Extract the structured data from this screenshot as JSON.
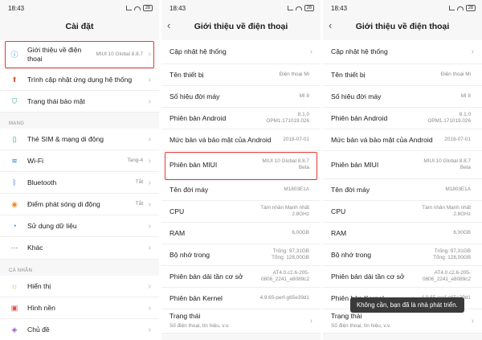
{
  "status": {
    "time": "18:43",
    "battery": "28"
  },
  "p1": {
    "title": "Cài đặt",
    "items_top": [
      {
        "label": "Giới thiệu về điện thoại",
        "value": "MIUI 10 Global 8.8.7",
        "icon": "info-icon"
      },
      {
        "label": "Trình cập nhật ứng dụng hệ thống",
        "value": "",
        "icon": "update-icon"
      },
      {
        "label": "Trạng thái bảo mật",
        "value": "",
        "icon": "shield-icon"
      }
    ],
    "section_network": "MẠNG",
    "items_network": [
      {
        "label": "Thẻ SIM & mạng di động",
        "value": "",
        "icon": "sim-icon"
      },
      {
        "label": "Wi-Fi",
        "value": "Tang-4",
        "icon": "wifi-icon"
      },
      {
        "label": "Bluetooth",
        "value": "Tắt",
        "icon": "bluetooth-icon"
      },
      {
        "label": "Điểm phát sóng di động",
        "value": "Tắt",
        "icon": "hotspot-icon"
      },
      {
        "label": "Sử dụng dữ liệu",
        "value": "",
        "icon": "data-usage-icon"
      },
      {
        "label": "Khác",
        "value": "",
        "icon": "more-icon"
      }
    ],
    "section_personal": "CÁ NHÂN",
    "items_personal": [
      {
        "label": "Hiển thị",
        "value": "",
        "icon": "display-icon"
      },
      {
        "label": "Hình nền",
        "value": "",
        "icon": "wallpaper-icon"
      },
      {
        "label": "Chủ đề",
        "value": "",
        "icon": "theme-icon"
      }
    ]
  },
  "about": {
    "title": "Giới thiệu về điện thoại",
    "rows": [
      {
        "label": "Cập nhật hệ thống",
        "v1": "",
        "v2": ""
      },
      {
        "label": "Tên thiết bị",
        "v1": "Điện thoại Mi",
        "v2": ""
      },
      {
        "label": "Số hiệu đời máy",
        "v1": "MI 8",
        "v2": ""
      },
      {
        "label": "Phiên bản Android",
        "v1": "8.1.0",
        "v2": "OPM1.171019.026"
      },
      {
        "label": "Mức bản vá bảo mật của Android",
        "v1": "2018-07-01",
        "v2": ""
      },
      {
        "label": "Phiên bản MIUI",
        "v1": "MIUI 10 Global 8.8.7",
        "v2": "Beta"
      },
      {
        "label": "Tên đời máy",
        "v1": "M1803E1A",
        "v2": ""
      },
      {
        "label": "CPU",
        "v1": "Tám nhân Mạnh nhất",
        "v2": "2.8GHz"
      },
      {
        "label": "RAM",
        "v1": "6,00GB",
        "v2": ""
      },
      {
        "label": "Bộ nhớ trong",
        "v1": "Trống: 97,31GB",
        "v2": "Tổng: 128,00GB"
      },
      {
        "label": "Phiên bản dải tần cơ sở",
        "v1": "AT4.0.c2.6-205-",
        "v2": "0806_2241_e8089c2"
      },
      {
        "label": "Phiên bản Kernel",
        "v1": "4.9.65-perf-g65e39d1",
        "v2": ""
      },
      {
        "label": "Trạng thái",
        "sub": "Số điện thoại, tín hiệu, v.v.",
        "v1": "",
        "v2": ""
      }
    ]
  },
  "toast": "Không cần, bạn đã là nhà phát triển."
}
